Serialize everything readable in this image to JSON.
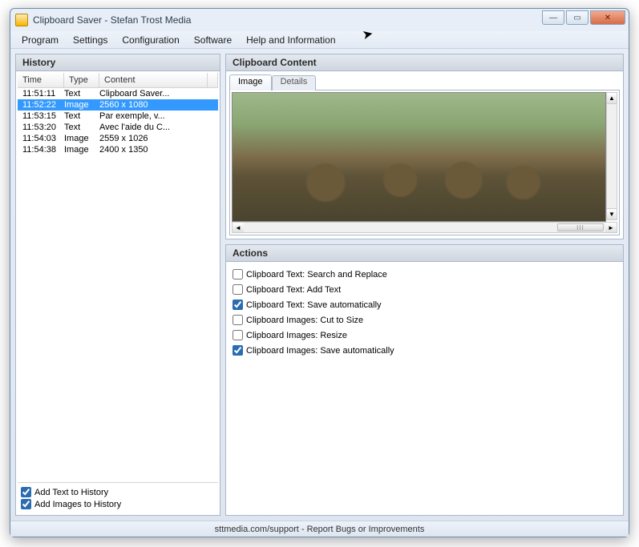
{
  "window": {
    "title": "Clipboard Saver - Stefan Trost Media"
  },
  "menu": {
    "program": "Program",
    "settings": "Settings",
    "configuration": "Configuration",
    "software": "Software",
    "help": "Help and Information"
  },
  "history": {
    "title": "History",
    "cols": {
      "time": "Time",
      "type": "Type",
      "content": "Content"
    },
    "rows": [
      {
        "time": "11:51:11",
        "type": "Text",
        "content": "Clipboard Saver...",
        "selected": false
      },
      {
        "time": "11:52:22",
        "type": "Image",
        "content": "2560 x 1080",
        "selected": true
      },
      {
        "time": "11:53:15",
        "type": "Text",
        "content": "Par exemple, v...",
        "selected": false
      },
      {
        "time": "11:53:20",
        "type": "Text",
        "content": "Avec l'aide du C...",
        "selected": false
      },
      {
        "time": "11:54:03",
        "type": "Image",
        "content": "2559 x 1026",
        "selected": false
      },
      {
        "time": "11:54:38",
        "type": "Image",
        "content": "2400 x 1350",
        "selected": false
      }
    ],
    "footer": {
      "add_text": {
        "label": "Add Text to History",
        "checked": true
      },
      "add_images": {
        "label": "Add Images to History",
        "checked": true
      }
    }
  },
  "content": {
    "title": "Clipboard Content",
    "tabs": {
      "image": "Image",
      "details": "Details",
      "active": "image"
    }
  },
  "actions": {
    "title": "Actions",
    "items": [
      {
        "label": "Clipboard Text: Search and Replace",
        "checked": false
      },
      {
        "label": "Clipboard Text: Add Text",
        "checked": false
      },
      {
        "label": "Clipboard Text: Save automatically",
        "checked": true
      },
      {
        "label": "Clipboard Images: Cut to Size",
        "checked": false
      },
      {
        "label": "Clipboard Images: Resize",
        "checked": false
      },
      {
        "label": "Clipboard Images: Save automatically",
        "checked": true
      }
    ]
  },
  "status": "sttmedia.com/support - Report Bugs or Improvements"
}
